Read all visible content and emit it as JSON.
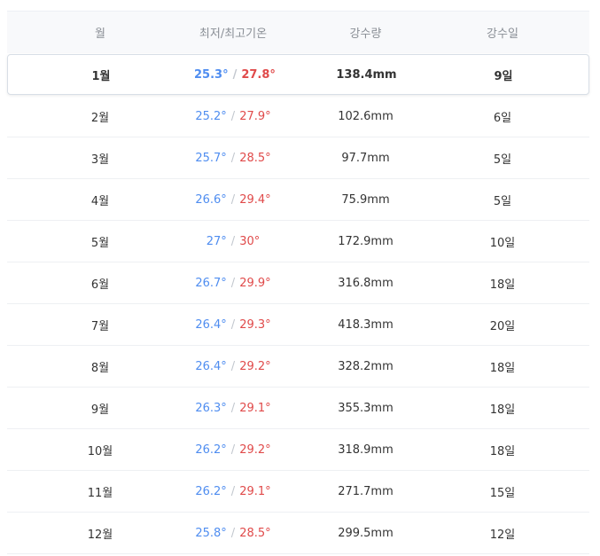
{
  "headers": {
    "month": "월",
    "temp": "최저/최고기온",
    "rain": "강수량",
    "days": "강수일"
  },
  "separator": "/",
  "rows": [
    {
      "month": "1월",
      "low": "25.3°",
      "high": "27.8°",
      "rain": "138.4mm",
      "days": "9일"
    },
    {
      "month": "2월",
      "low": "25.2°",
      "high": "27.9°",
      "rain": "102.6mm",
      "days": "6일"
    },
    {
      "month": "3월",
      "low": "25.7°",
      "high": "28.5°",
      "rain": "97.7mm",
      "days": "5일"
    },
    {
      "month": "4월",
      "low": "26.6°",
      "high": "29.4°",
      "rain": "75.9mm",
      "days": "5일"
    },
    {
      "month": "5월",
      "low": "27°",
      "high": "30°",
      "rain": "172.9mm",
      "days": "10일"
    },
    {
      "month": "6월",
      "low": "26.7°",
      "high": "29.9°",
      "rain": "316.8mm",
      "days": "18일"
    },
    {
      "month": "7월",
      "low": "26.4°",
      "high": "29.3°",
      "rain": "418.3mm",
      "days": "20일"
    },
    {
      "month": "8월",
      "low": "26.4°",
      "high": "29.2°",
      "rain": "328.2mm",
      "days": "18일"
    },
    {
      "month": "9월",
      "low": "26.3°",
      "high": "29.1°",
      "rain": "355.3mm",
      "days": "18일"
    },
    {
      "month": "10월",
      "low": "26.2°",
      "high": "29.2°",
      "rain": "318.9mm",
      "days": "18일"
    },
    {
      "month": "11월",
      "low": "26.2°",
      "high": "29.1°",
      "rain": "271.7mm",
      "days": "15일"
    },
    {
      "month": "12월",
      "low": "25.8°",
      "high": "28.5°",
      "rain": "299.5mm",
      "days": "12일"
    }
  ],
  "colors": {
    "low": "#4f8df0",
    "high": "#e04a4a"
  }
}
